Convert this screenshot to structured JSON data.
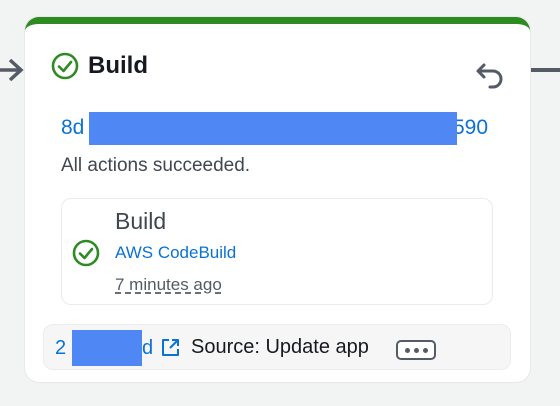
{
  "stage": {
    "title": "Build",
    "status": "succeeded",
    "status_icon": "check-circle-icon",
    "status_color": "#2e8b22",
    "retry_icon": "retry-arrow-icon",
    "summary": "All actions succeeded.",
    "commit": {
      "prefix": "8d",
      "suffix": "590",
      "redacted": true
    }
  },
  "action": {
    "title": "Build",
    "provider": "AWS CodeBuild",
    "time": "7 minutes ago",
    "status_icon": "check-circle-icon"
  },
  "source": {
    "commit_prefix": "2",
    "commit_suffix": "d",
    "redacted": true,
    "link_icon": "external-link-icon",
    "message": "Source: Update app",
    "more_icon": "ellipsis-icon"
  },
  "colors": {
    "link": "#0972d3",
    "success": "#2e8b22",
    "redaction": "#4f87f5"
  }
}
